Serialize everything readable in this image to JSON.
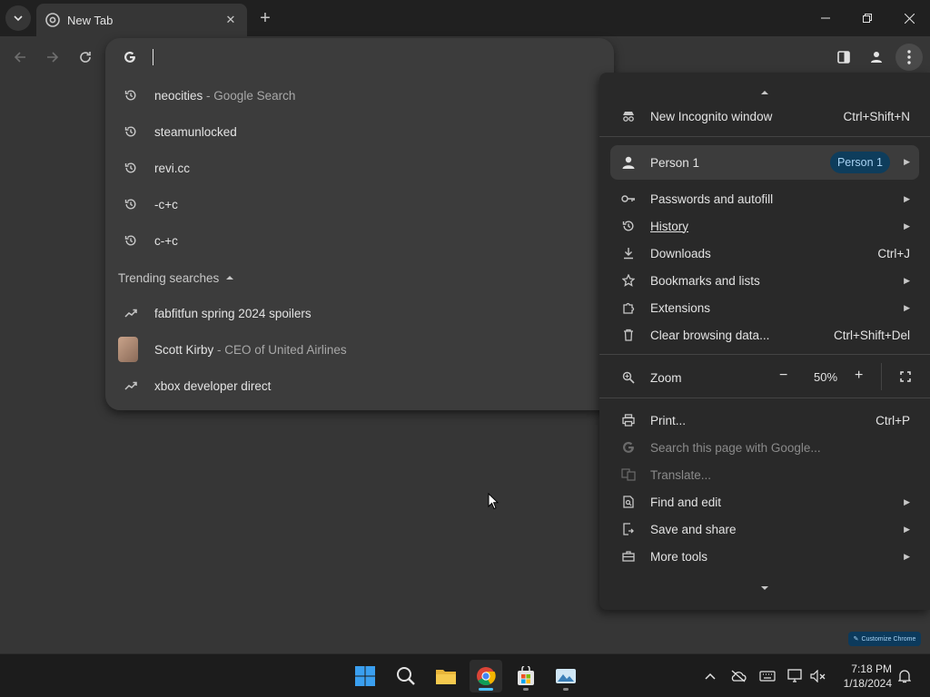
{
  "tab": {
    "title": "New Tab"
  },
  "omnibox": {
    "suggestions": [
      {
        "text": "neocities",
        "sub": " - Google Search"
      },
      {
        "text": "steamunlocked",
        "sub": ""
      },
      {
        "text": "revi.cc",
        "sub": ""
      },
      {
        "text": "-c+c",
        "sub": ""
      },
      {
        "text": "c-+c",
        "sub": ""
      }
    ],
    "trending_header": "Trending searches",
    "trending": [
      {
        "text": "fabfitfun spring 2024 spoilers",
        "sub": ""
      },
      {
        "text": "Scott Kirby",
        "sub": " - CEO of United Airlines"
      },
      {
        "text": "xbox developer direct",
        "sub": ""
      }
    ]
  },
  "menu": {
    "new_incognito": {
      "label": "New Incognito window",
      "shortcut": "Ctrl+Shift+N"
    },
    "person": {
      "label": "Person 1",
      "badge": "Person 1"
    },
    "passwords": "Passwords and autofill",
    "history": "History",
    "downloads": {
      "label": "Downloads",
      "shortcut": "Ctrl+J"
    },
    "bookmarks": "Bookmarks and lists",
    "extensions": "Extensions",
    "clear": {
      "label": "Clear browsing data...",
      "shortcut": "Ctrl+Shift+Del"
    },
    "zoom": {
      "label": "Zoom",
      "minus": "−",
      "value": "50%",
      "plus": "+"
    },
    "print": {
      "label": "Print...",
      "shortcut": "Ctrl+P"
    },
    "search_page": "Search this page with Google...",
    "translate": "Translate...",
    "find_edit": "Find and edit",
    "save_share": "Save and share",
    "more_tools": "More tools"
  },
  "customize_chip": "Customize Chrome",
  "taskbar": {
    "time": "7:18 PM",
    "date": "1/18/2024"
  },
  "colors": {
    "tabstrip_bg": "#202020",
    "content_bg": "#363636",
    "menu_bg": "#292929",
    "accent_badge": "#0e3d5c"
  }
}
